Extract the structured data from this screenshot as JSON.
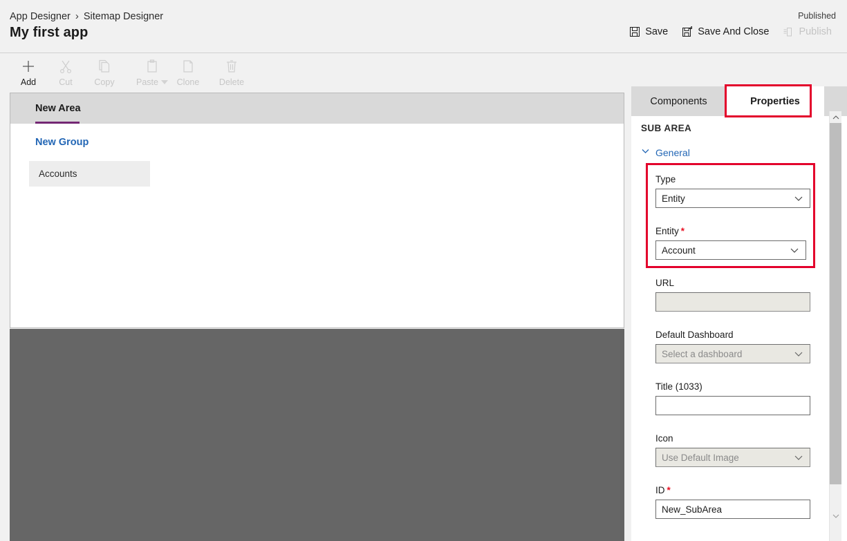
{
  "header": {
    "breadcrumb": [
      "App Designer",
      "Sitemap Designer"
    ],
    "breadcrumb_separator": "›",
    "app_title": "My first app",
    "published_status": "Published",
    "actions": [
      {
        "label": "Save",
        "icon": "save-icon",
        "disabled": false
      },
      {
        "label": "Save And Close",
        "icon": "save-and-close-icon",
        "disabled": false
      },
      {
        "label": "Publish",
        "icon": "publish-icon",
        "disabled": true
      }
    ]
  },
  "commandbar": {
    "items": [
      {
        "label": "Add",
        "icon": "plus-icon",
        "disabled": false,
        "dropdown": false
      },
      {
        "label": "Cut",
        "icon": "scissors-icon",
        "disabled": true,
        "dropdown": false
      },
      {
        "label": "Copy",
        "icon": "copy-icon",
        "disabled": true,
        "dropdown": false
      },
      {
        "label": "Paste",
        "icon": "paste-icon",
        "disabled": true,
        "dropdown": true
      },
      {
        "label": "Clone",
        "icon": "clone-icon",
        "disabled": true,
        "dropdown": false
      },
      {
        "label": "Delete",
        "icon": "trash-icon",
        "disabled": true,
        "dropdown": false
      }
    ]
  },
  "canvas": {
    "area_tab": "New Area",
    "group_title": "New Group",
    "subarea_item": "Accounts",
    "accent_color": "#742774"
  },
  "panel": {
    "tabs": [
      {
        "label": "Components",
        "active": false
      },
      {
        "label": "Properties",
        "active": true
      }
    ],
    "heading": "SUB AREA",
    "section": {
      "label": "General",
      "expanded": true,
      "icon": "chevron-down-icon"
    },
    "fields": [
      {
        "name": "type",
        "label": "Type",
        "required": false,
        "control": "dropdown",
        "value": "Entity",
        "placeholder": "",
        "disabled": false
      },
      {
        "name": "entity",
        "label": "Entity",
        "required": true,
        "control": "dropdown",
        "value": "Account",
        "placeholder": "",
        "disabled": false
      },
      {
        "name": "url",
        "label": "URL",
        "required": false,
        "control": "text",
        "value": "",
        "placeholder": "",
        "disabled": true
      },
      {
        "name": "default_dashboard",
        "label": "Default Dashboard",
        "required": false,
        "control": "dropdown",
        "value": "",
        "placeholder": "Select a dashboard",
        "disabled": true
      },
      {
        "name": "title",
        "label": "Title (1033)",
        "required": false,
        "control": "text",
        "value": "",
        "placeholder": "",
        "disabled": false
      },
      {
        "name": "icon",
        "label": "Icon",
        "required": false,
        "control": "dropdown",
        "value": "",
        "placeholder": "Use Default Image",
        "disabled": true
      },
      {
        "name": "id",
        "label": "ID",
        "required": true,
        "control": "text",
        "value": "New_SubArea",
        "placeholder": "",
        "disabled": false
      }
    ]
  },
  "annotations": {
    "color": "#e3002b",
    "boxes": [
      "properties-tab",
      "type-and-entity-fields"
    ]
  }
}
